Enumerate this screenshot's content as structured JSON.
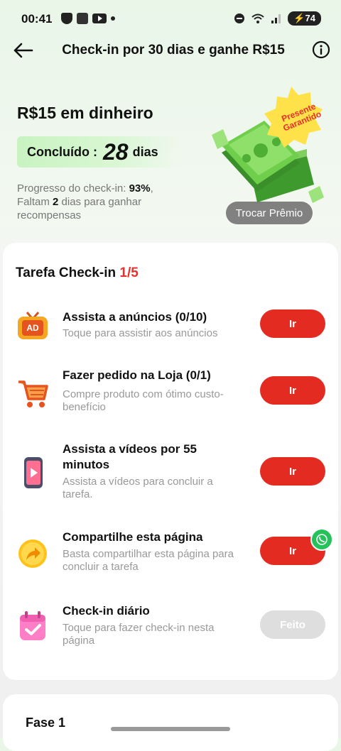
{
  "status_bar": {
    "time": "00:41",
    "battery": "74",
    "icons": [
      "shield-icon",
      "app-icon",
      "youtube-icon",
      "dot-icon",
      "dnd-icon",
      "wifi-icon",
      "signal-icon",
      "battery-icon"
    ]
  },
  "nav": {
    "title": "Check-in por 30 dias e ganhe R$15",
    "back_icon": "arrow-left-icon",
    "info_icon": "info-icon"
  },
  "hero": {
    "reward_title": "R$15 em dinheiro",
    "done_label": "Concluído :",
    "done_count": "28",
    "done_unit": "dias",
    "progress_prefix": "Progresso do check-in: ",
    "progress_value": "93%",
    "progress_suffix": ",",
    "remaining_prefix": "Faltam ",
    "remaining_value": "2",
    "remaining_suffix": " dias para ganhar recompensas",
    "badge_line1": "Presente",
    "badge_line2": "Garantido",
    "redeem_button": "Trocar Prêmio"
  },
  "tasks_card": {
    "title": "Tarefa Check-in ",
    "count": "1/5",
    "tasks": [
      {
        "name": "Assista a anúncios  (0/10)",
        "desc": "Toque para assistir aos anúncios",
        "button": "Ir",
        "icon": "tv-ad-icon",
        "icon_text": "AD"
      },
      {
        "name": "Fazer pedido na Loja  (0/1)",
        "desc": "Compre produto com ótimo custo-benefício",
        "button": "Ir",
        "icon": "shopping-cart-icon"
      },
      {
        "name": "Assista a vídeos por 55 minutos",
        "desc": "Assista a vídeos para concluir a tarefa.",
        "button": "Ir",
        "icon": "video-phone-icon"
      },
      {
        "name": "Compartilhe esta página",
        "desc": "Basta compartilhar esta página para concluir a tarefa",
        "button": "Ir",
        "icon": "share-arrow-icon"
      },
      {
        "name": "Check-in diário",
        "desc": "Toque para fazer check-in nesta página",
        "button": "Feito",
        "icon": "calendar-check-icon"
      }
    ]
  },
  "phase_card": {
    "title": "Fase 1"
  },
  "colors": {
    "accent_red": "#e42b21",
    "success_green": "#c9f3c2",
    "whatsapp_green": "#25c15a",
    "muted_gray": "#999999"
  }
}
